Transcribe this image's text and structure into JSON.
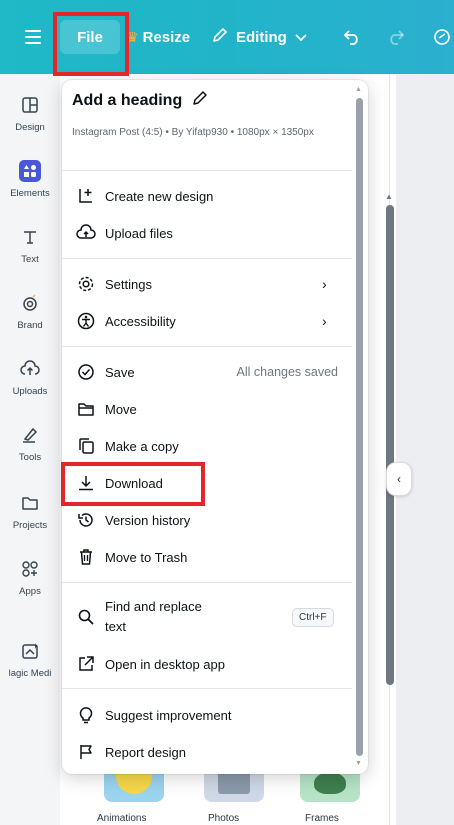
{
  "topbar": {
    "file_label": "File",
    "resize_label": "Resize",
    "editing_label": "Editing"
  },
  "rail": {
    "items": [
      {
        "label": "Design",
        "icon": "layout-icon"
      },
      {
        "label": "Elements",
        "icon": "elements-icon"
      },
      {
        "label": "Text",
        "icon": "text-icon"
      },
      {
        "label": "Brand",
        "icon": "brand-icon"
      },
      {
        "label": "Uploads",
        "icon": "upload-cloud-icon"
      },
      {
        "label": "Tools",
        "icon": "pen-tool-icon"
      },
      {
        "label": "Projects",
        "icon": "folder-icon"
      },
      {
        "label": "Apps",
        "icon": "apps-grid-icon"
      },
      {
        "label": "lagic Medi",
        "icon": "magic-media-icon"
      }
    ]
  },
  "menu": {
    "title": "Add a heading",
    "subtitle": "Instagram Post (4:5) • By Yifatp930 • 1080px × 1350px",
    "items": {
      "create_new_design": "Create new design",
      "upload_files": "Upload files",
      "settings": "Settings",
      "accessibility": "Accessibility",
      "save": "Save",
      "save_status": "All changes saved",
      "move": "Move",
      "make_a_copy": "Make a copy",
      "download": "Download",
      "version_history": "Version history",
      "move_to_trash": "Move to Trash",
      "find_and_replace_line1": "Find and replace",
      "find_and_replace_line2": "text",
      "find_shortcut": "Ctrl+F",
      "open_in_desktop": "Open in desktop app",
      "suggest_improvement": "Suggest improvement",
      "report_design": "Report design"
    }
  },
  "panel": {
    "thumbs": [
      "Animations",
      "Photos",
      "Frames"
    ]
  },
  "colors": {
    "topbar": "#21b4c9",
    "highlight": "#e3262a",
    "elements_badge": "#4958d8"
  }
}
